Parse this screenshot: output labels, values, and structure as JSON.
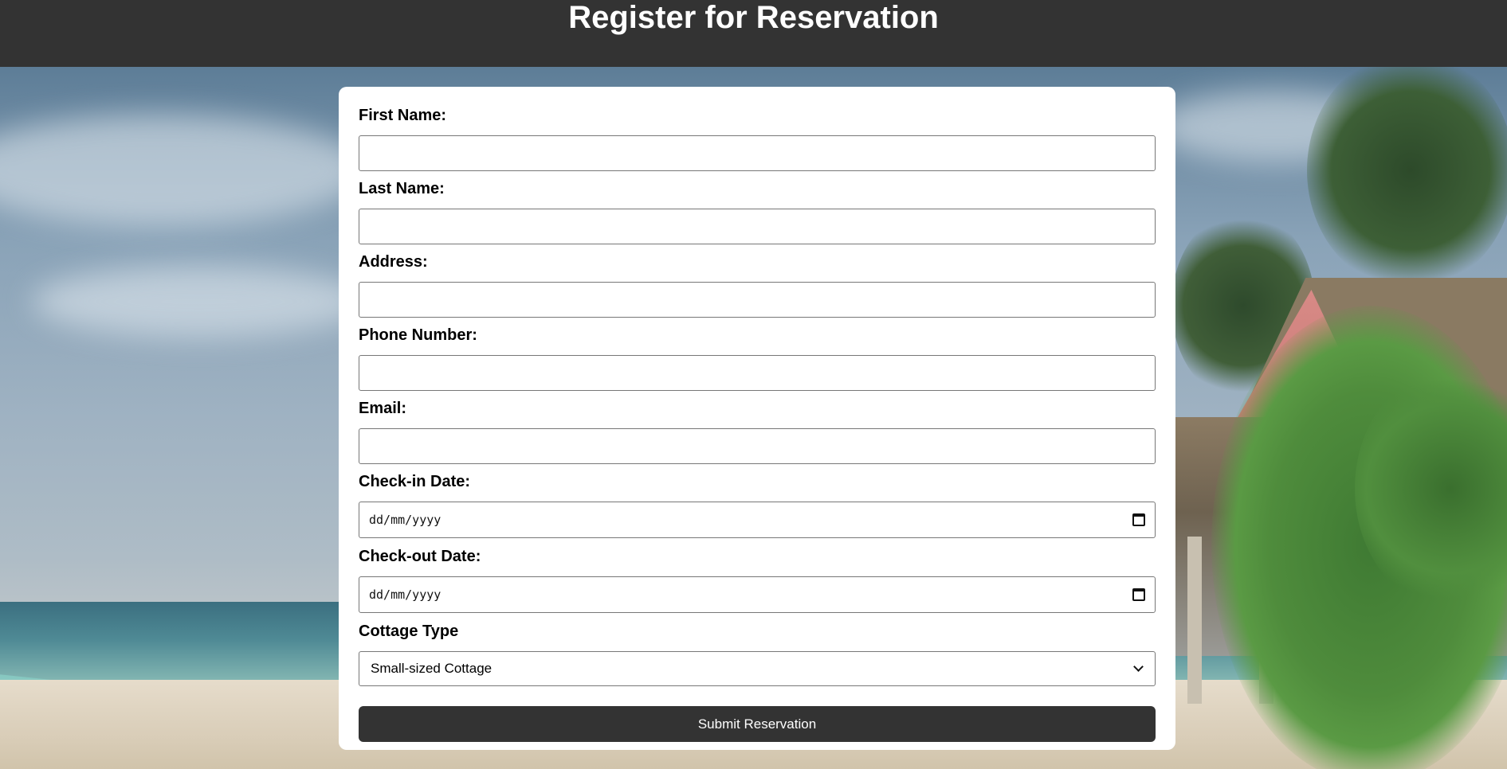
{
  "header": {
    "title": "Register for Reservation"
  },
  "form": {
    "first_name": {
      "label": "First Name:",
      "value": ""
    },
    "last_name": {
      "label": "Last Name:",
      "value": ""
    },
    "address": {
      "label": "Address:",
      "value": ""
    },
    "phone": {
      "label": "Phone Number:",
      "value": ""
    },
    "email": {
      "label": "Email:",
      "value": ""
    },
    "check_in": {
      "label": "Check-in Date:",
      "placeholder": "dd/mm/yyyy"
    },
    "check_out": {
      "label": "Check-out Date:",
      "placeholder": "dd/mm/yyyy"
    },
    "cottage_type": {
      "label": "Cottage Type",
      "selected": "Small-sized Cottage"
    },
    "submit_label": "Submit Reservation"
  },
  "colors": {
    "header_bg": "#333333",
    "button_bg": "#333333",
    "card_bg": "#ffffff"
  }
}
